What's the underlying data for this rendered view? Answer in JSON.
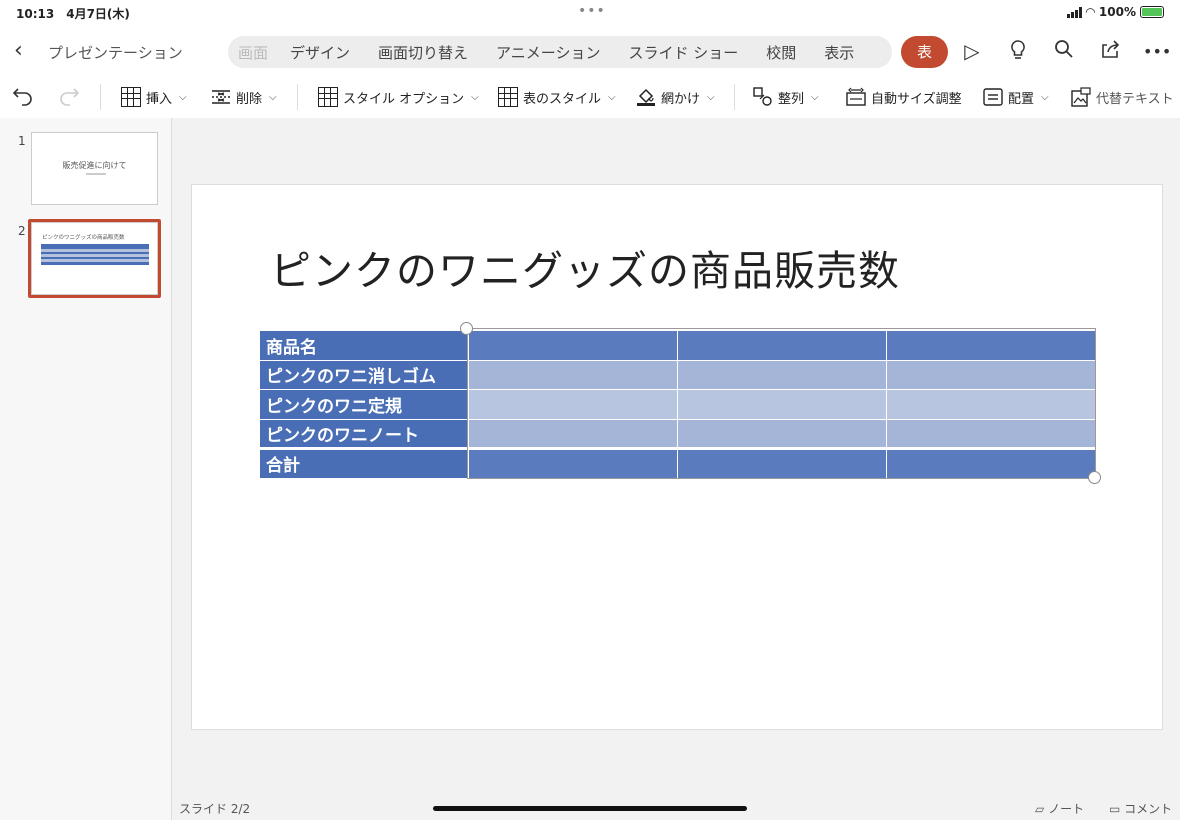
{
  "status": {
    "time": "10:13",
    "date": "4月7日(木)",
    "battery": "100%"
  },
  "app": {
    "back_icon": "chevron-left-icon",
    "doc_title": "プレゼンテーション"
  },
  "tabs": [
    {
      "label": "画面",
      "faded": true
    },
    {
      "label": "デザイン"
    },
    {
      "label": "画面切り替え"
    },
    {
      "label": "アニメーション"
    },
    {
      "label": "スライド ショー"
    },
    {
      "label": "校閲"
    },
    {
      "label": "表示"
    }
  ],
  "active_tab": {
    "label": "表",
    "color": "#c24a31"
  },
  "toolbar_icons": [
    "play-icon",
    "lightbulb-icon",
    "search-icon",
    "share-icon",
    "more-icon"
  ],
  "ribbon": {
    "insert": "挿入",
    "delete": "削除",
    "style_options": "スタイル オプション",
    "table_styles": "表のスタイル",
    "shading": "網かけ",
    "arrange": "整列",
    "autofit": "自動サイズ調整",
    "align": "配置",
    "alt_text": "代替テキスト"
  },
  "thumbnails": [
    {
      "number": "1",
      "title": "販売促進に向けて"
    },
    {
      "number": "2",
      "title": "ピンクのワニグッズの商品販売数",
      "selected": true
    }
  ],
  "slide": {
    "title": "ピンクのワニグッズの商品販売数",
    "table": {
      "rows": [
        {
          "header": "商品名",
          "cells": [
            "",
            "",
            ""
          ]
        },
        {
          "header": "ピンクのワニ消しゴム",
          "cells": [
            "",
            "",
            ""
          ]
        },
        {
          "header": "ピンクのワニ定規",
          "cells": [
            "",
            "",
            ""
          ]
        },
        {
          "header": "ピンクのワニノート",
          "cells": [
            "",
            "",
            ""
          ]
        },
        {
          "header": "合計",
          "cells": [
            "",
            "",
            ""
          ]
        }
      ],
      "header_color": "#4a6eb5"
    }
  },
  "footer": {
    "slide_count": "スライド 2/2",
    "notes": "ノート",
    "comments": "コメント"
  }
}
